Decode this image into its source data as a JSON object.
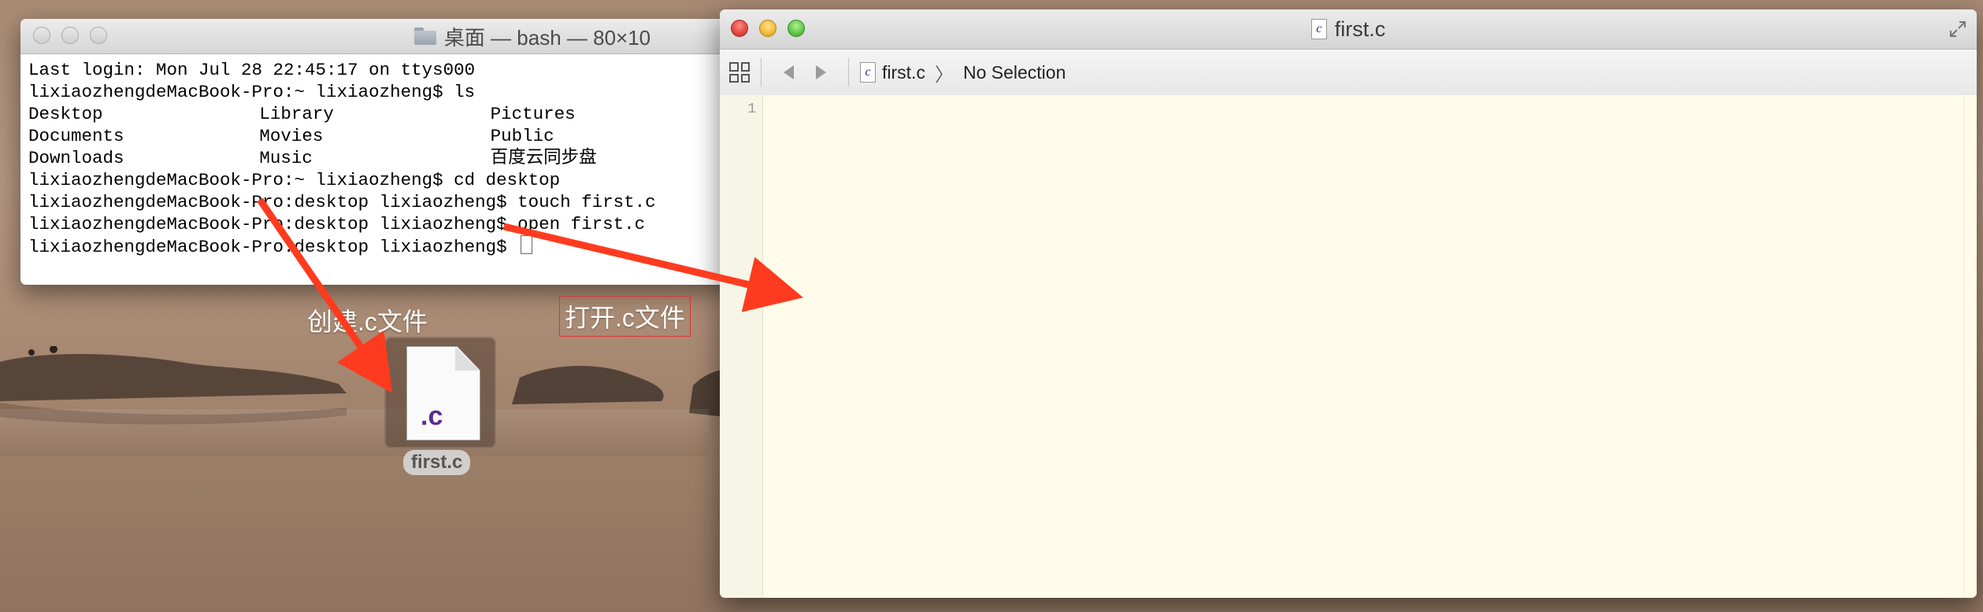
{
  "terminal": {
    "title": "桌面 — bash — 80×10",
    "lines": {
      "login": "Last login: Mon Jul 28 22:45:17 on ttys000",
      "cmd_ls": "lixiaozhengdeMacBook-Pro:~ lixiaozheng$ ls",
      "cmd_cd": "lixiaozhengdeMacBook-Pro:~ lixiaozheng$ cd desktop",
      "cmd_touch": "lixiaozhengdeMacBook-Pro:desktop lixiaozheng$ touch first.c",
      "cmd_open": "lixiaozhengdeMacBook-Pro:desktop lixiaozheng$ open first.c",
      "prompt": "lixiaozhengdeMacBook-Pro:desktop lixiaozheng$ "
    },
    "ls_output": [
      [
        "Desktop",
        "Library",
        "Pictures"
      ],
      [
        "Documents",
        "Movies",
        "Public"
      ],
      [
        "Downloads",
        "Music",
        "百度云同步盘"
      ]
    ]
  },
  "desktop": {
    "file_ext": ".c",
    "file_name": "first.c",
    "annotation_create": "创建.c文件",
    "annotation_open": "打开.c文件"
  },
  "editor": {
    "title": "first.c",
    "file_icon_glyph": "c",
    "breadcrumb_file": "first.c",
    "breadcrumb_selection": "No Selection",
    "line_number": "1"
  },
  "colors": {
    "annotation_arrow": "#ff3b1f",
    "editor_bg": "#fffdea",
    "file_ext": "#5a2d8c"
  }
}
